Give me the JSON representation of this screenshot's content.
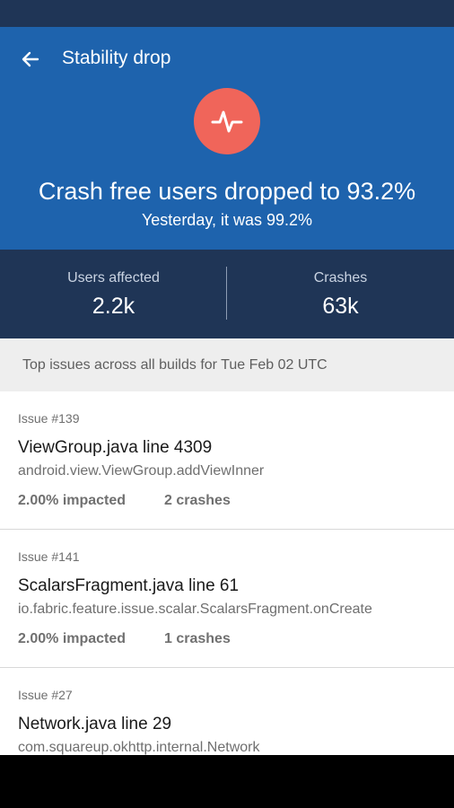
{
  "colors": {
    "status_bar": "#1f3556",
    "hero_background": "#1e63ad",
    "pulse_circle": "#f0655a",
    "stats_background": "#1f3556",
    "section_header_background": "#eeeeee",
    "navigation_bar": "#000000"
  },
  "toolbar": {
    "back_icon": "arrow-left-icon",
    "title": "Stability drop"
  },
  "hero": {
    "icon": "pulse-icon",
    "headline": "Crash free users dropped to 93.2%",
    "subline": "Yesterday, it was 99.2%"
  },
  "stats": [
    {
      "label": "Users affected",
      "value": "2.2k"
    },
    {
      "label": "Crashes",
      "value": "63k"
    }
  ],
  "section": {
    "header": "Top issues across all builds for Tue Feb 02 UTC"
  },
  "issues": [
    {
      "number": "Issue #139",
      "title": "ViewGroup.java line 4309",
      "method": "android.view.ViewGroup.addViewInner",
      "impacted": "2.00% impacted",
      "crashes": "2 crashes"
    },
    {
      "number": "Issue #141",
      "title": "ScalarsFragment.java line 61",
      "method": "io.fabric.feature.issue.scalar.ScalarsFragment.onCreate",
      "impacted": "2.00% impacted",
      "crashes": "1 crashes"
    },
    {
      "number": "Issue #27",
      "title": "Network.java line 29",
      "method": "com.squareup.okhttp.internal.Network"
    }
  ]
}
